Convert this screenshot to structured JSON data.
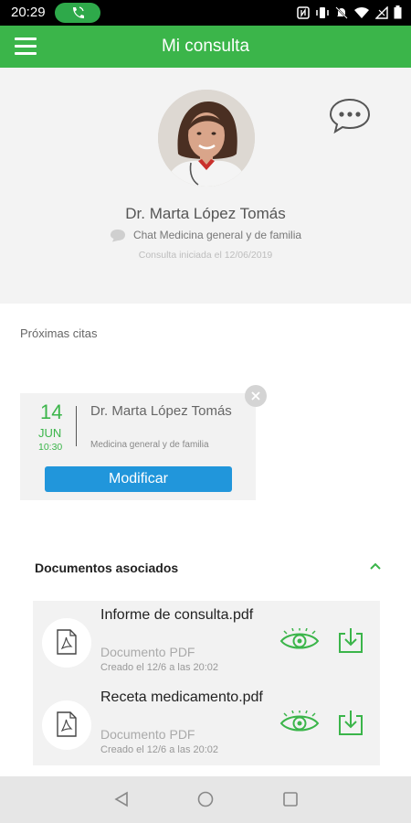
{
  "status_bar": {
    "time": "20:29",
    "icons": [
      "call-active-icon",
      "nfc-icon",
      "vibrate-icon",
      "mute-icon",
      "wifi-icon",
      "signal-icon",
      "battery-icon"
    ]
  },
  "app_bar": {
    "title": "Mi consulta",
    "menu_icon": "hamburger-menu-icon"
  },
  "profile": {
    "doctor_name": "Dr. Marta López Tomás",
    "specialty": "Chat Medicina general y de familia",
    "consult_started": "Consulta iniciada el 12/06/2019",
    "chat_icon": "chat-bubble-icon"
  },
  "appointments": {
    "title": "Próximas citas",
    "items": [
      {
        "day": "14",
        "month": "JUN",
        "time": "10:30",
        "doctor": "Dr. Marta López Tomás",
        "specialty": "Medicina general y de familia",
        "button_label": "Modificar"
      }
    ]
  },
  "documents": {
    "title": "Documentos asociados",
    "items": [
      {
        "name": "Informe de consulta.pdf",
        "type": "Documento PDF",
        "created": "Creado el 12/6 a las 20:02"
      },
      {
        "name": "Receta medicamento.pdf",
        "type": "Documento PDF",
        "created": "Creado el 12/6 a las 20:02"
      }
    ]
  },
  "colors": {
    "brand_green": "#3bb54a",
    "button_blue": "#2196db",
    "status_green": "#2ea94a"
  }
}
